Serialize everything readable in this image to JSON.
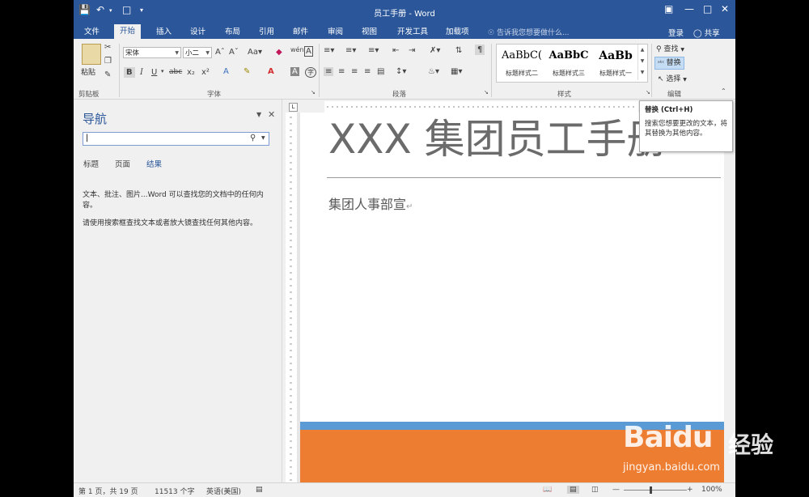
{
  "title_bar": {
    "title": "员工手册 - Word"
  },
  "tabs": [
    "文件",
    "开始",
    "插入",
    "设计",
    "布局",
    "引用",
    "邮件",
    "审阅",
    "视图",
    "开发工具",
    "加载项"
  ],
  "active_tab": "开始",
  "tell_me": "告诉我您想要做什么...",
  "account": {
    "login": "登录",
    "share": "共享"
  },
  "clipboard": {
    "paste": "粘贴",
    "group": "剪贴板"
  },
  "font": {
    "name": "宋体",
    "size": "小二",
    "group": "字体"
  },
  "paragraph": {
    "group": "段落"
  },
  "styles": {
    "items": [
      {
        "sample": "AaBbC(",
        "name": "标题样式二"
      },
      {
        "sample": "AaBbC",
        "name": "标题样式三"
      },
      {
        "sample": "AaBb",
        "name": "标题样式一"
      }
    ],
    "group": "样式"
  },
  "editing": {
    "find": "查找",
    "replace": "替换",
    "select": "选择",
    "group": "编辑"
  },
  "nav": {
    "title": "导航",
    "tabs": [
      "标题",
      "页面",
      "结果"
    ],
    "active": "结果",
    "msg1": "文本、批注、图片...Word 可以查找您的文档中的任何内容。",
    "msg2": "请使用搜索框查找文本或者放大镜查找任何其他内容。"
  },
  "document": {
    "title": "XXX 集团员工手册",
    "subtitle": "集团人事部宣"
  },
  "status": {
    "page": "第 1 页，共 19 页",
    "words": "11513 个字",
    "language": "英语(美国)",
    "zoom": "100%"
  },
  "tooltip": {
    "title": "替换 (Ctrl+H)",
    "body": "搜索您想要更改的文本，将其替换为其他内容。"
  },
  "watermark": {
    "logo": "Baidu",
    "logo2": "经验",
    "url": "jingyan.baidu.com"
  },
  "colors": {
    "ribbon_blue": "#2b579a",
    "band_blue": "#5b9bd5",
    "band_orange": "#ed7d31"
  }
}
